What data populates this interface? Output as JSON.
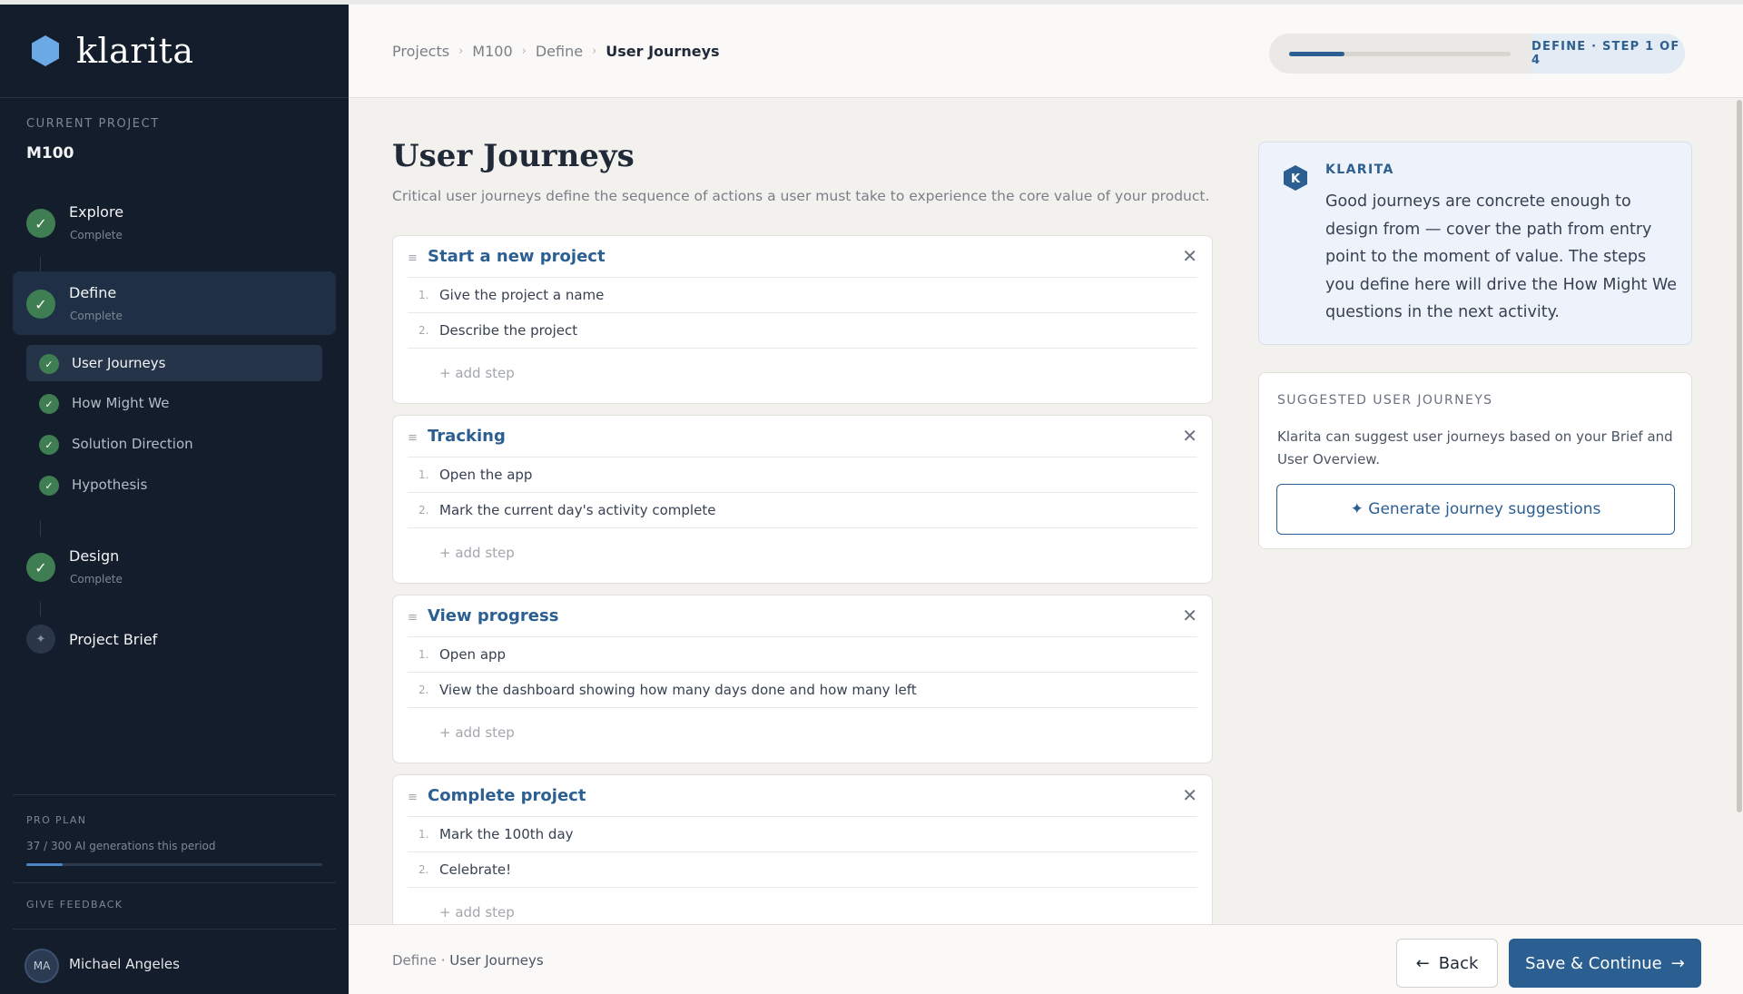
{
  "app": {
    "name": "klarita"
  },
  "sidebar": {
    "current_project_label": "CURRENT PROJECT",
    "current_project_name": "M100",
    "stages": [
      {
        "title": "Explore",
        "status": "Complete"
      },
      {
        "title": "Define",
        "status": "Complete"
      },
      {
        "title": "Design",
        "status": "Complete"
      }
    ],
    "define_substeps": [
      {
        "label": "User Journeys"
      },
      {
        "label": "How Might We"
      },
      {
        "label": "Solution Direction"
      },
      {
        "label": "Hypothesis"
      }
    ],
    "project_brief_label": "Project Brief",
    "plan": {
      "label": "PRO PLAN",
      "usage_text": "37 / 300 AI generations this period",
      "used": 37,
      "total": 300
    },
    "feedback_label": "GIVE FEEDBACK",
    "user": {
      "initials": "MA",
      "name": "Michael Angeles"
    }
  },
  "header": {
    "breadcrumbs": [
      "Projects",
      "M100",
      "Define",
      "User Journeys"
    ],
    "step_label": "DEFINE · STEP 1 OF 4",
    "step_progress_fraction": 0.25
  },
  "main": {
    "title": "User Journeys",
    "description": "Critical user journeys define the sequence of actions a user must take to experience the core value of your product.",
    "add_step_label": "+ add step",
    "journeys": [
      {
        "title": "Start a new project",
        "steps": [
          "Give the project a name",
          "Describe the project"
        ]
      },
      {
        "title": "Tracking",
        "steps": [
          "Open the app",
          "Mark the current day's activity complete"
        ]
      },
      {
        "title": "View progress",
        "steps": [
          "Open app",
          "View the dashboard showing how many days done and how many left"
        ]
      },
      {
        "title": "Complete project",
        "steps": [
          "Mark the 100th day",
          "Celebrate!"
        ]
      }
    ]
  },
  "assistant": {
    "badge_letter": "K",
    "label": "KLARITA",
    "message": "Good journeys are concrete enough to design from — cover the path from entry point to the moment of value. The steps you define here will drive the How Might We questions in the next activity."
  },
  "suggestions": {
    "label": "SUGGESTED USER JOURNEYS",
    "text": "Klarita can suggest user journeys based on your Brief and User Overview.",
    "button_label": "✦ Generate journey suggestions"
  },
  "footer": {
    "crumb_prefix": "Define ·",
    "crumb_current": "User Journeys",
    "back_label": "Back",
    "save_label": "Save & Continue"
  },
  "colors": {
    "accent": "#2c5f91",
    "sidebar_bg": "#131d2b",
    "complete_green": "#3f7d53",
    "logo_hex": "#6aa9e6"
  }
}
